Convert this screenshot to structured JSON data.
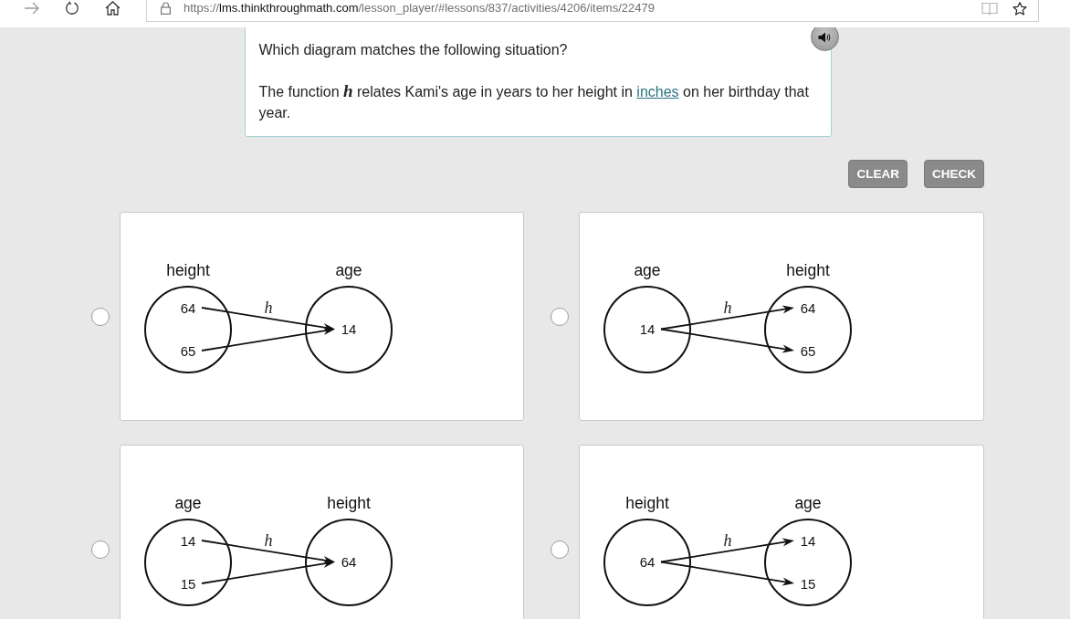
{
  "browser": {
    "forward_disabled": true,
    "url": {
      "scheme": "https://",
      "host": "lms.thinkthroughmath.com",
      "path": "/lesson_player/#lessons/837/activities/4206/items/22479"
    }
  },
  "question": {
    "prompt": "Which diagram matches the following situation?",
    "situation": [
      {
        "kind": "text",
        "text": "The function "
      },
      {
        "kind": "math",
        "text": "h"
      },
      {
        "kind": "text",
        "text": " relates Kami's age in years to her height in "
      },
      {
        "kind": "link",
        "text": "inches"
      },
      {
        "kind": "text",
        "text": " on her birthday that year."
      }
    ]
  },
  "actions": [
    {
      "label": "CLEAR",
      "disabled": true
    },
    {
      "label": "CHECK",
      "disabled": true
    }
  ],
  "options": [
    {
      "selected": false,
      "diagram": {
        "function": "h",
        "domain": {
          "label": "height",
          "items": [
            "64",
            "65"
          ]
        },
        "codomain": {
          "label": "age",
          "items": [
            "14"
          ]
        }
      }
    },
    {
      "selected": false,
      "diagram": {
        "function": "h",
        "domain": {
          "label": "age",
          "items": [
            "14"
          ]
        },
        "codomain": {
          "label": "height",
          "items": [
            "64",
            "65"
          ]
        }
      }
    },
    {
      "selected": false,
      "diagram": {
        "function": "h",
        "domain": {
          "label": "age",
          "items": [
            "14",
            "15"
          ]
        },
        "codomain": {
          "label": "height",
          "items": [
            "64"
          ]
        }
      }
    },
    {
      "selected": false,
      "diagram": {
        "function": "h",
        "domain": {
          "label": "height",
          "items": [
            "64"
          ]
        },
        "codomain": {
          "label": "age",
          "items": [
            "14",
            "15"
          ]
        }
      }
    }
  ]
}
